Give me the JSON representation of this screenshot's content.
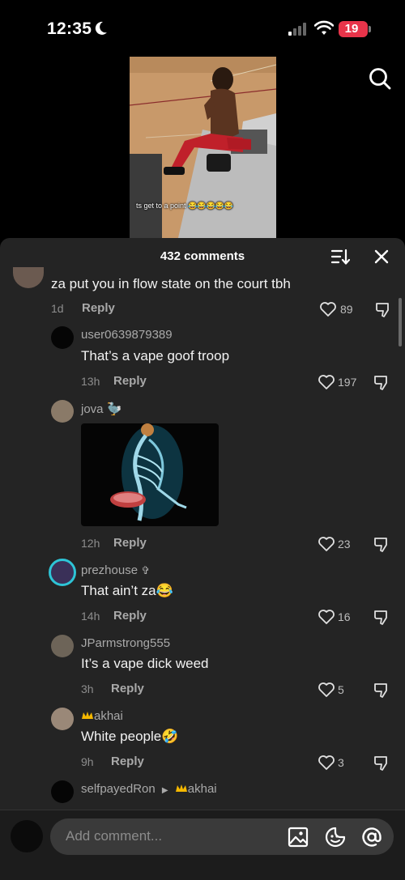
{
  "status_bar": {
    "time": "12:35",
    "battery": "19"
  },
  "video": {
    "caption": "ts get to a point 😂😂😂😂😂"
  },
  "comments_sheet": {
    "title": "432 comments",
    "comments": [
      {
        "text": "za put you in flow state on the court tbh",
        "time": "1d",
        "reply_label": "Reply",
        "likes": "89"
      },
      {
        "username": "user0639879389",
        "text": "That’s a vape goof troop",
        "time": "13h",
        "reply_label": "Reply",
        "likes": "197"
      },
      {
        "username": "jova",
        "username_emoji": "🦤",
        "time": "12h",
        "reply_label": "Reply",
        "likes": "23"
      },
      {
        "username": "prezhouse",
        "username_suffix": "✞",
        "text": "That ain’t za",
        "text_emoji": "😂",
        "time": "14h",
        "reply_label": "Reply",
        "likes": "16"
      },
      {
        "username": "JParmstrong555",
        "text": "It’s a vape dick weed",
        "time": "3h",
        "reply_label": "Reply",
        "likes": "5"
      },
      {
        "username": "akhai",
        "text": "White people",
        "text_emoji": "🤣",
        "time": "9h",
        "reply_label": "Reply",
        "likes": "3"
      },
      {
        "username": "selfpayedRon",
        "reply_to": "akhai"
      }
    ]
  },
  "composer": {
    "placeholder": "Add comment..."
  },
  "icons": [
    "moon-icon",
    "signal-icon",
    "wifi-icon",
    "search-icon",
    "sort-icon",
    "close-icon",
    "heart-icon",
    "dislike-icon",
    "image-icon",
    "emoji-icon",
    "mention-icon"
  ],
  "colors": {
    "sheet_bg": "#242424",
    "battery": "#e8344a",
    "accent_crown": "#f5b800",
    "ring": "#2ec4d6"
  }
}
